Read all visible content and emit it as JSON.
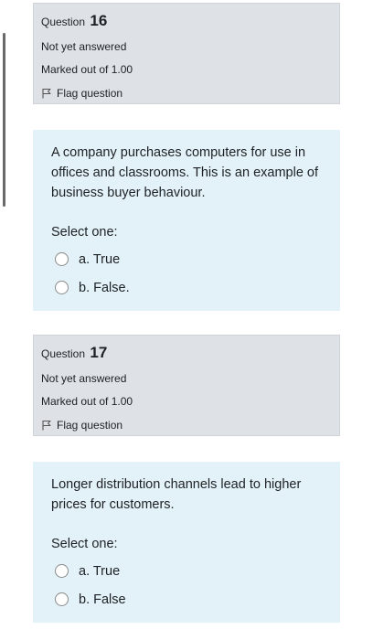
{
  "questions": [
    {
      "label": "Question",
      "number": "16",
      "state": "Not yet answered",
      "grade": "Marked out of 1.00",
      "flag_label": "Flag question",
      "text": "A company purchases computers for use in offices and classrooms. This is an example of business buyer behaviour.",
      "prompt": "Select one:",
      "options": [
        "a. True",
        "b. False."
      ]
    },
    {
      "label": "Question",
      "number": "17",
      "state": "Not yet answered",
      "grade": "Marked out of 1.00",
      "flag_label": "Flag question",
      "text": "Longer distribution channels lead to higher prices for customers.",
      "prompt": "Select one:",
      "options": [
        "a. True",
        "b. False"
      ]
    }
  ],
  "icons": {
    "flag": "flag-outline-icon",
    "radio": "radio-unselected"
  },
  "colors": {
    "info_bg": "#dee2e6",
    "content_bg": "#e3f2f8",
    "text": "#1d2125"
  }
}
